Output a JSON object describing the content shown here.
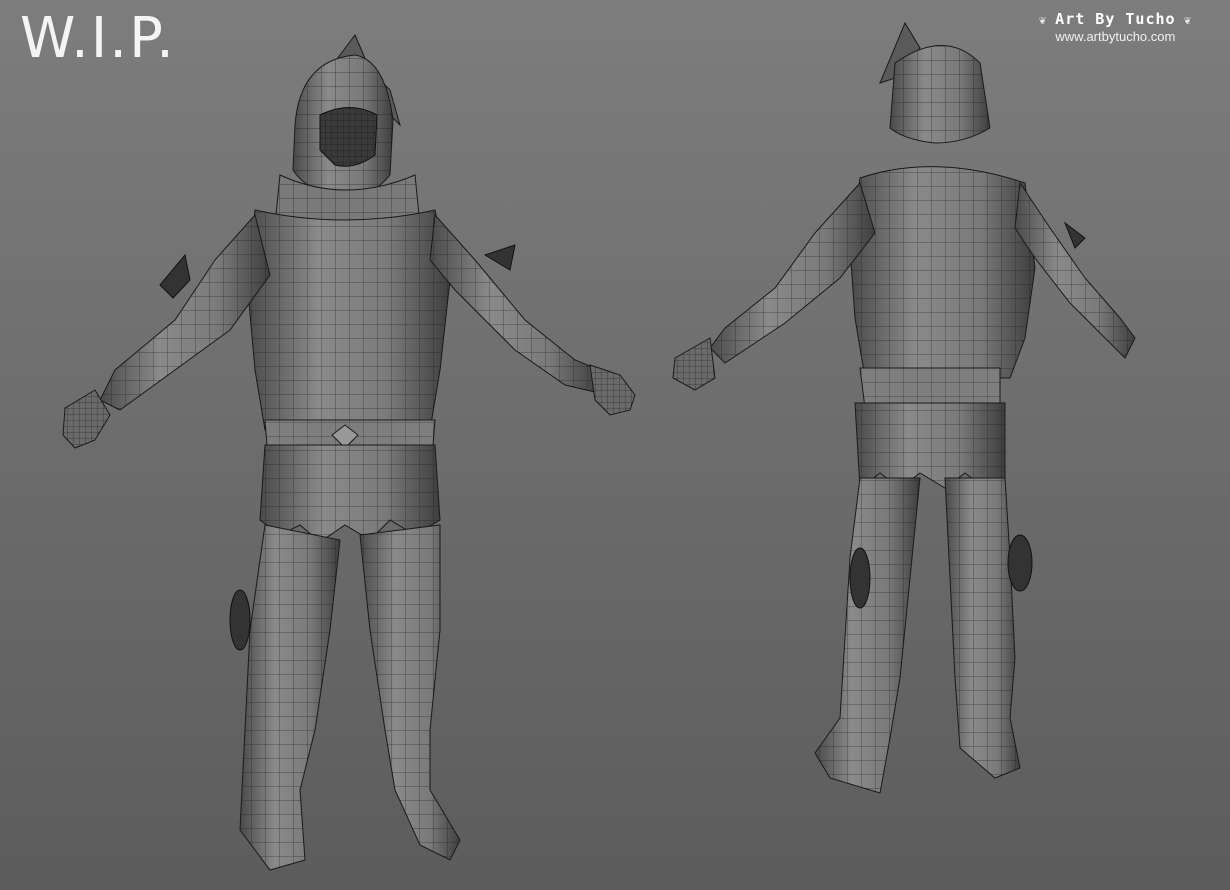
{
  "title": "W.I.P.",
  "watermark": {
    "logo": "Art By Tucho",
    "url": "www.artbytucho.com"
  },
  "colors": {
    "background_top": "#7d7d7d",
    "background_bottom": "#5c5c5c",
    "mesh_light": "#8a8a8a",
    "mesh_mid": "#6a6a6a",
    "mesh_dark": "#3a3a3a",
    "wire": "#1a1a1a",
    "text": "#f4f4f4"
  },
  "views": [
    {
      "name": "front-view"
    },
    {
      "name": "back-view"
    }
  ]
}
